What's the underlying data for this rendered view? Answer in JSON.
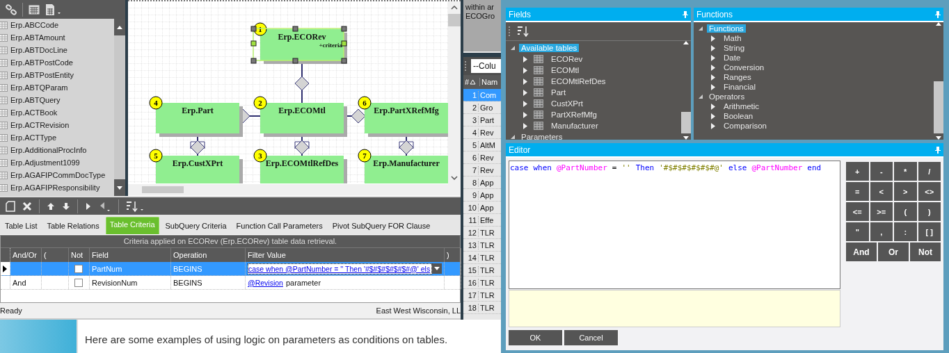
{
  "table_list": {
    "items": [
      "Erp.ABCCode",
      "Erp.ABTAmount",
      "Erp.ABTDocLine",
      "Erp.ABTPostCode",
      "Erp.ABTPostEntity",
      "Erp.ABTQParam",
      "Erp.ABTQuery",
      "Erp.ACTBook",
      "Erp.ACTRevision",
      "Erp.ACTType",
      "Erp.AdditionalProcInfo",
      "Erp.Adjustment1099",
      "Erp.AGAFIPCommDocType",
      "Erp.AGAFIPResponsibility"
    ]
  },
  "diagram": {
    "nodes": [
      {
        "number": "1",
        "title": "Erp.ECORev",
        "note": "+criteria",
        "selected": true
      },
      {
        "number": "4",
        "title": "Erp.Part",
        "selected": false
      },
      {
        "number": "2",
        "title": "Erp.ECOMtl",
        "selected": false
      },
      {
        "number": "6",
        "title": "Erp.PartXRefMfg",
        "selected": false
      },
      {
        "number": "5",
        "title": "Erp.CustXPrt",
        "selected": false
      },
      {
        "number": "3",
        "title": "Erp.ECOMtlRefDes",
        "selected": false
      },
      {
        "number": "7",
        "title": "Erp.Manufacturer",
        "selected": false
      }
    ]
  },
  "tabs": [
    {
      "label": "Table List",
      "selected": false
    },
    {
      "label": "Table Relations",
      "selected": false
    },
    {
      "label": "Table Criteria",
      "selected": true
    },
    {
      "label": "SubQuery Criteria",
      "selected": false
    },
    {
      "label": "Function Call Parameters",
      "selected": false
    },
    {
      "label": "Pivot SubQuery FOR Clause",
      "selected": false
    }
  ],
  "criteria": {
    "caption": "Criteria applied on ECORev (Erp.ECORev)  table data retrieval.",
    "columns": [
      "And/Or",
      "(",
      "Not",
      "Field",
      "Operation",
      "Filter Value",
      ")"
    ],
    "rows": [
      {
        "selected": true,
        "not": false,
        "field": "PartNum",
        "operation": "BEGINS",
        "filter_link": "case when @PartNumber = '' Then '#$#$#$#$#$#@' els"
      },
      {
        "selected": false,
        "and_or": "And",
        "not": false,
        "field": "RevisionNum",
        "operation": "BEGINS",
        "filter_link": "@Revision",
        "filter_text": "parameter"
      }
    ]
  },
  "status_bar": {
    "left": "Ready",
    "right": "East West Wisconsin, LL"
  },
  "side_panel": {
    "lines": [
      "within ar",
      "ECOGro"
    ],
    "column_chooser": "--Colu",
    "columns": [
      "#",
      "Nam"
    ],
    "rows": [
      {
        "number": "1",
        "name": "Com",
        "selected": true
      },
      {
        "number": "2",
        "name": "Gro",
        "selected": false
      },
      {
        "number": "3",
        "name": "Part",
        "selected": false
      },
      {
        "number": "4",
        "name": "Rev",
        "selected": false
      },
      {
        "number": "5",
        "name": "AltM",
        "selected": false
      },
      {
        "number": "6",
        "name": "Rev",
        "selected": false
      },
      {
        "number": "7",
        "name": "Rev",
        "selected": false
      },
      {
        "number": "8",
        "name": "App",
        "selected": false
      },
      {
        "number": "9",
        "name": "App",
        "selected": false
      },
      {
        "number": "10",
        "name": "App",
        "selected": false
      },
      {
        "number": "11",
        "name": "Effe",
        "selected": false
      },
      {
        "number": "12",
        "name": "TLR",
        "selected": false
      },
      {
        "number": "13",
        "name": "TLR",
        "selected": false
      },
      {
        "number": "14",
        "name": "TLR",
        "selected": false
      },
      {
        "number": "15",
        "name": "TLR",
        "selected": false
      },
      {
        "number": "16",
        "name": "TLR",
        "selected": false
      },
      {
        "number": "17",
        "name": "TLR",
        "selected": false
      },
      {
        "number": "18",
        "name": "TLR",
        "selected": false
      }
    ]
  },
  "post": {
    "text": "Here are some examples of using logic on parameters as conditions on tables."
  },
  "dialog": {
    "fields": {
      "title": "Fields",
      "tree": [
        {
          "label": "Available tables",
          "selected": true,
          "expanded": true,
          "children": [
            {
              "label": "ECORev",
              "expanded": false
            },
            {
              "label": "ECOMtl",
              "expanded": false
            },
            {
              "label": "ECOMtlRefDes",
              "expanded": false
            },
            {
              "label": "Part",
              "expanded": false
            },
            {
              "label": "CustXPrt",
              "expanded": false
            },
            {
              "label": "PartXRefMfg",
              "expanded": false
            },
            {
              "label": "Manufacturer",
              "expanded": false
            }
          ]
        },
        {
          "label": "Parameters",
          "selected": false,
          "expanded": true
        }
      ]
    },
    "functions": {
      "title": "Functions",
      "tree": [
        {
          "label": "Functions",
          "selected": true,
          "expanded": true,
          "children": [
            {
              "label": "Math",
              "expanded": false
            },
            {
              "label": "String",
              "expanded": false
            },
            {
              "label": "Date",
              "expanded": false
            },
            {
              "label": "Conversion",
              "expanded": false
            },
            {
              "label": "Ranges",
              "expanded": false
            },
            {
              "label": "Financial",
              "expanded": false
            }
          ]
        },
        {
          "label": "Operators",
          "selected": false,
          "expanded": true,
          "children": [
            {
              "label": "Arithmetic",
              "expanded": false
            },
            {
              "label": "Boolean",
              "expanded": false
            },
            {
              "label": "Comparison",
              "expanded": false
            }
          ]
        }
      ]
    },
    "editor": {
      "title": "Editor",
      "tokens": [
        {
          "text": "case",
          "kind": "keyword"
        },
        {
          "text": "when",
          "kind": "keyword"
        },
        {
          "text": "@PartNumber",
          "kind": "variable"
        },
        {
          "text": "=",
          "kind": "operator"
        },
        {
          "text": "''",
          "kind": "string"
        },
        {
          "text": "Then",
          "kind": "keyword"
        },
        {
          "text": "'#$#$#$#$#$#@'",
          "kind": "string"
        },
        {
          "text": "else",
          "kind": "keyword"
        },
        {
          "text": "@PartNumber",
          "kind": "variable"
        },
        {
          "text": "end",
          "kind": "keyword"
        }
      ]
    },
    "keys": [
      {
        "label": "+",
        "kind": "symbol"
      },
      {
        "label": "-",
        "kind": "symbol"
      },
      {
        "label": "*",
        "kind": "symbol"
      },
      {
        "label": "/",
        "kind": "symbol"
      },
      {
        "label": "=",
        "kind": "symbol"
      },
      {
        "label": "<",
        "kind": "symbol"
      },
      {
        "label": ">",
        "kind": "symbol"
      },
      {
        "label": "<>",
        "kind": "symbol"
      },
      {
        "label": "<=",
        "kind": "symbol"
      },
      {
        "label": ">=",
        "kind": "symbol"
      },
      {
        "label": "(",
        "kind": "symbol"
      },
      {
        "label": ")",
        "kind": "symbol"
      },
      {
        "label": "\"",
        "kind": "symbol"
      },
      {
        "label": ",",
        "kind": "symbol"
      },
      {
        "label": ":",
        "kind": "symbol"
      },
      {
        "label": "[ ]",
        "kind": "symbol"
      },
      {
        "label": "And",
        "kind": "word"
      },
      {
        "label": "Or",
        "kind": "word"
      },
      {
        "label": "Not",
        "kind": "word"
      }
    ],
    "buttons": [
      "OK",
      "Cancel"
    ]
  }
}
